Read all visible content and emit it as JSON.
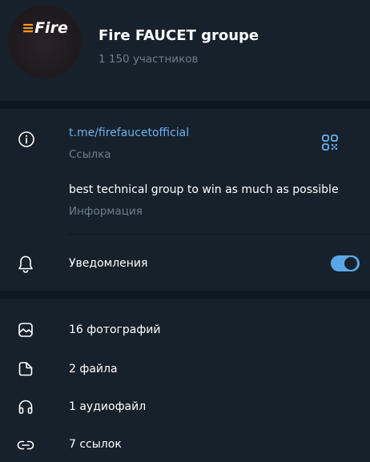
{
  "group": {
    "logo_text": "Fire",
    "title": "Fire FAUCET groupe",
    "members": "1 150 участников"
  },
  "info": {
    "link": "t.me/firefaucetofficial",
    "link_caption": "Ссылка",
    "description": "best technical group to win as much as possible",
    "description_caption": "Информация"
  },
  "notifications": {
    "label": "Уведомления",
    "enabled": true
  },
  "media": {
    "photos": "16 фотографий",
    "files": "2 файла",
    "audio": "1 аудиофайл",
    "links": "7 ссылок"
  },
  "colors": {
    "background": "#17212b",
    "divider": "#0e1621",
    "accent": "#6ab2f2",
    "toggle": "#5aa7e8",
    "muted": "#6d7f8f",
    "logo": "#f29a1d"
  }
}
